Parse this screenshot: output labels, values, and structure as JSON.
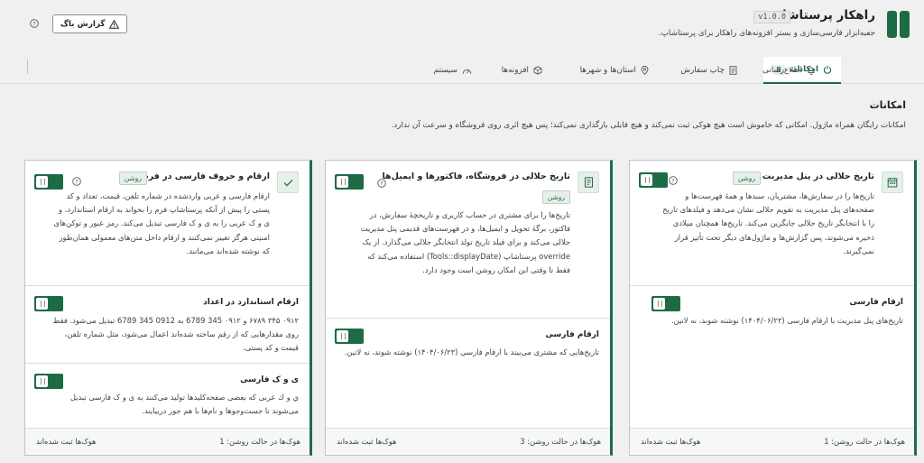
{
  "header": {
    "title": "راهکار پرستاشاپ",
    "version": "v1.0.0",
    "description": "جعبه‌ابزار فارسی‌سازی و بستر افزونه‌های راهکار برای پرستاشاپ.",
    "bug_report": "گزارش باگ"
  },
  "tabs": [
    {
      "label": "امکانات",
      "badge": "8",
      "icon": "power-icon"
    },
    {
      "label": "اطلاع‌رسانی",
      "icon": "bell-icon"
    },
    {
      "label": "چاپ سفارش",
      "icon": "document-icon"
    },
    {
      "label": "استان‌ها و شهرها",
      "icon": "location-pin-icon"
    },
    {
      "label": "افزونه‌ها",
      "icon": "box-icon"
    },
    {
      "label": "سیستم",
      "icon": "speed-gauge-icon"
    }
  ],
  "section": {
    "title": "امکانات",
    "description": "امکانات رایگان همراه ماژول. امکانی که خاموش است هیچ هوکی ثبت نمی‌کند و هیچ فایلی بارگذاری نمی‌کند؛ پس هیچ اثری روی فروشگاه و سرعت آن ندارد."
  },
  "cards": [
    {
      "title": "تاریخ جلالی در پنل مدیریت",
      "status": "روشن",
      "icon": "calendar-icon",
      "description": "تاریخ‌ها را در سفارش‌ها، مشتریان، سبدها و همهٔ فهرست‌ها و صفحه‌های پنل مدیریت به تقویم جلالی نشان می‌دهد و فیلدهای تاریخ را با انتخابگر تاریخ جلالی جایگزین می‌کند. تاریخ‌ها همچنان میلادی ذخیره می‌شوند، پس گزارش‌ها و ماژول‌های دیگر تحت تأثیر قرار نمی‌گیرند.",
      "subs": [
        {
          "title": "ارقام فارسی",
          "description": "تاریخ‌های پنل مدیریت با ارقام فارسی (۱۴۰۴/۰۶/۲۳) نوشته شوند، نه لاتین."
        }
      ],
      "footer_hooks": "هوک‌ها در حالت روشن: 1",
      "footer_registered": "هوک‌ها ثبت شده‌اند"
    },
    {
      "title": "تاریخ جلالی در فروشگاه، فاکتورها و ایمیل‌ها",
      "status": "روشن",
      "icon": "invoice-icon",
      "description": "تاریخ‌ها را برای مشتری در حساب کاربری و تاریخچهٔ سفارش، در فاکتور، برگهٔ تحویل و ایمیل‌ها، و در فهرست‌های قدیمی پنل مدیریت جلالی می‌کند و برای فیلد تاریخ تولد انتخابگر جلالی می‌گذارد. از یک override پرستاشاپ (Tools::displayDate) استفاده می‌کند که فقط تا وقتی این امکان روشن است وجود دارد.",
      "subs": [
        {
          "title": "ارقام فارسی",
          "description": "تاریخ‌هایی که مشتری می‌بیند با ارقام فارسی (۱۴۰۴/۰۶/۲۳) نوشته شوند، نه لاتین."
        }
      ],
      "footer_hooks": "هوک‌ها در حالت روشن: 3",
      "footer_registered": "هوک‌ها ثبت شده‌اند"
    },
    {
      "title": "ارقام و حروف فارسی در فرم‌ها",
      "status": "روشن",
      "icon": "check-icon",
      "description": "ارقام فارسی و عربی واردشده در شماره تلفن، قیمت، تعداد و کد پستی را پیش از آنکه پرستاشاپ فرم را بخواند به ارقام استاندارد، و ی و ک عربی را به ی و ک فارسی تبدیل می‌کند. رمز عبور و توکن‌های امنیتی هرگز تغییر نمی‌کنند و ارقام داخل متن‌های معمولی همان‌طور که نوشته شده‌اند می‌مانند.",
      "subs": [
        {
          "title": "ارقام استاندارد در اعداد",
          "description": "۰۹۱۲ ۳۴۵ ۶۷۸۹ و ٠٩١٢ 345 6789 به 0912 345 6789 تبدیل می‌شود. فقط روی مقدارهایی که از رقم ساخته شده‌اند اعمال می‌شود، مثل شماره تلفن، قیمت و کد پستی."
        },
        {
          "title": "ی و ک فارسی",
          "description": "ي و ك عربی که بعضی صفحه‌کلیدها تولید می‌کنند به ی و ک فارسی تبدیل می‌شوند تا جست‌وجوها و نام‌ها با هم جور دربیایند."
        }
      ],
      "footer_hooks": "هوک‌ها در حالت روشن: 1",
      "footer_registered": "هوک‌ها ثبت شده‌اند"
    }
  ]
}
